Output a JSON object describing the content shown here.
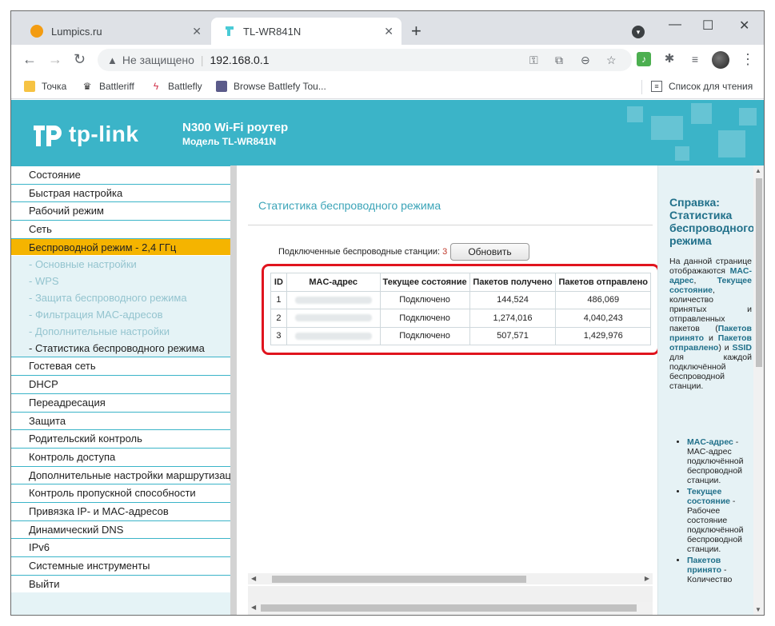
{
  "browser": {
    "tabs": [
      {
        "title": "Lumpics.ru",
        "icon": "orange-circle-icon"
      },
      {
        "title": "TL-WR841N",
        "icon": "tplink-icon"
      }
    ],
    "new_tab": "+",
    "window_controls": {
      "minimize": "—",
      "maximize": "☐",
      "close": "✕"
    },
    "address": {
      "warning": "Не защищено",
      "url": "192.168.0.1"
    },
    "bookmarks": [
      {
        "label": "Точка",
        "icon": "folder-icon"
      },
      {
        "label": "Battleriff",
        "icon": "battleriff-icon"
      },
      {
        "label": "Battlefly",
        "icon": "battlefly-icon"
      },
      {
        "label": "Browse Battlefy Tou...",
        "icon": "battlefy-icon"
      }
    ],
    "reading_list": "Список для чтения"
  },
  "router": {
    "brand": "tp-link",
    "model_line1": "N300 Wi-Fi роутер",
    "model_line2": "Модель TL-WR841N",
    "menu": [
      "Состояние",
      "Быстрая настройка",
      "Рабочий режим",
      "Сеть",
      "Беспроводной режим - 2,4 ГГц",
      "Гостевая сеть",
      "DHCP",
      "Переадресация",
      "Защита",
      "Родительский контроль",
      "Контроль доступа",
      "Дополнительные настройки маршрутизации",
      "Контроль пропускной способности",
      "Привязка IP- и MAC-адресов",
      "Динамический DNS",
      "IPv6",
      "Системные инструменты",
      "Выйти"
    ],
    "submenu": [
      "- Основные настройки",
      "- WPS",
      "- Защита беспроводного режима",
      "- Фильтрация MAC-адресов",
      "- Дополнительные настройки",
      "- Статистика беспроводного режима"
    ],
    "main": {
      "title": "Статистика беспроводного режима",
      "stations_label": "Подключенные беспроводные станции:",
      "stations_count": "3",
      "refresh_button": "Обновить",
      "headers": [
        "ID",
        "MAC-адрес",
        "Текущее состояние",
        "Пакетов получено",
        "Пакетов отправлено"
      ],
      "rows": [
        {
          "id": "1",
          "status": "Подключено",
          "received": "144,524",
          "sent": "486,069"
        },
        {
          "id": "2",
          "status": "Подключено",
          "received": "1,274,016",
          "sent": "4,040,243"
        },
        {
          "id": "3",
          "status": "Подключено",
          "received": "507,571",
          "sent": "1,429,976"
        }
      ]
    },
    "help": {
      "title": "Справка: Статистика беспроводного режима",
      "intro_1": "На данной странице отображаются ",
      "mac_link": "MAC-адрес",
      "comma": ", ",
      "status_link": "Текущее состояние",
      "intro_2": ", количество принятых и отправленных пакетов (",
      "received_link": "Пакетов принято",
      "and": " и ",
      "sent_link": "Пакетов отправлено",
      "intro_3": ") и ",
      "ssid_link": "SSID",
      "intro_4": " для каждой подключённой беспроводной станции.",
      "list": [
        {
          "term": "MAC-адрес",
          "desc": " - MAC-адрес подключённой беспроводной станции."
        },
        {
          "term": "Текущее состояние",
          "desc": " - Рабочее состояние подключённой беспроводной станции."
        },
        {
          "term": "Пакетов принято",
          "desc": " - Количество"
        }
      ]
    }
  }
}
